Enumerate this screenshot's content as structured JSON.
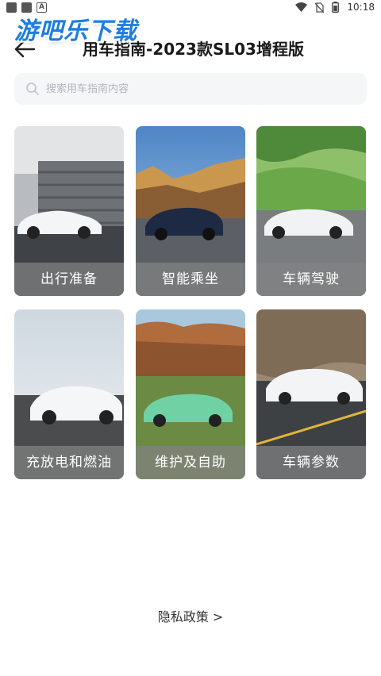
{
  "status_bar": {
    "time": "10:18",
    "left_icons": [
      "app-notification-icon",
      "app-notification-icon",
      "a-notification-icon"
    ],
    "right_icons": [
      "wifi-icon",
      "no-sim-icon",
      "battery-icon"
    ]
  },
  "watermark": {
    "text": "游吧乐下载"
  },
  "header": {
    "back_icon": "arrow-left-icon",
    "title": "用车指南-2023款SL03增程版"
  },
  "search": {
    "icon": "search-icon",
    "placeholder": "搜索用车指南内容"
  },
  "categories": [
    {
      "label": "出行准备"
    },
    {
      "label": "智能乘坐"
    },
    {
      "label": "车辆驾驶"
    },
    {
      "label": "充放电和燃油"
    },
    {
      "label": "维护及自助"
    },
    {
      "label": "车辆参数"
    }
  ],
  "footer": {
    "privacy_link": "隐私政策 >"
  }
}
